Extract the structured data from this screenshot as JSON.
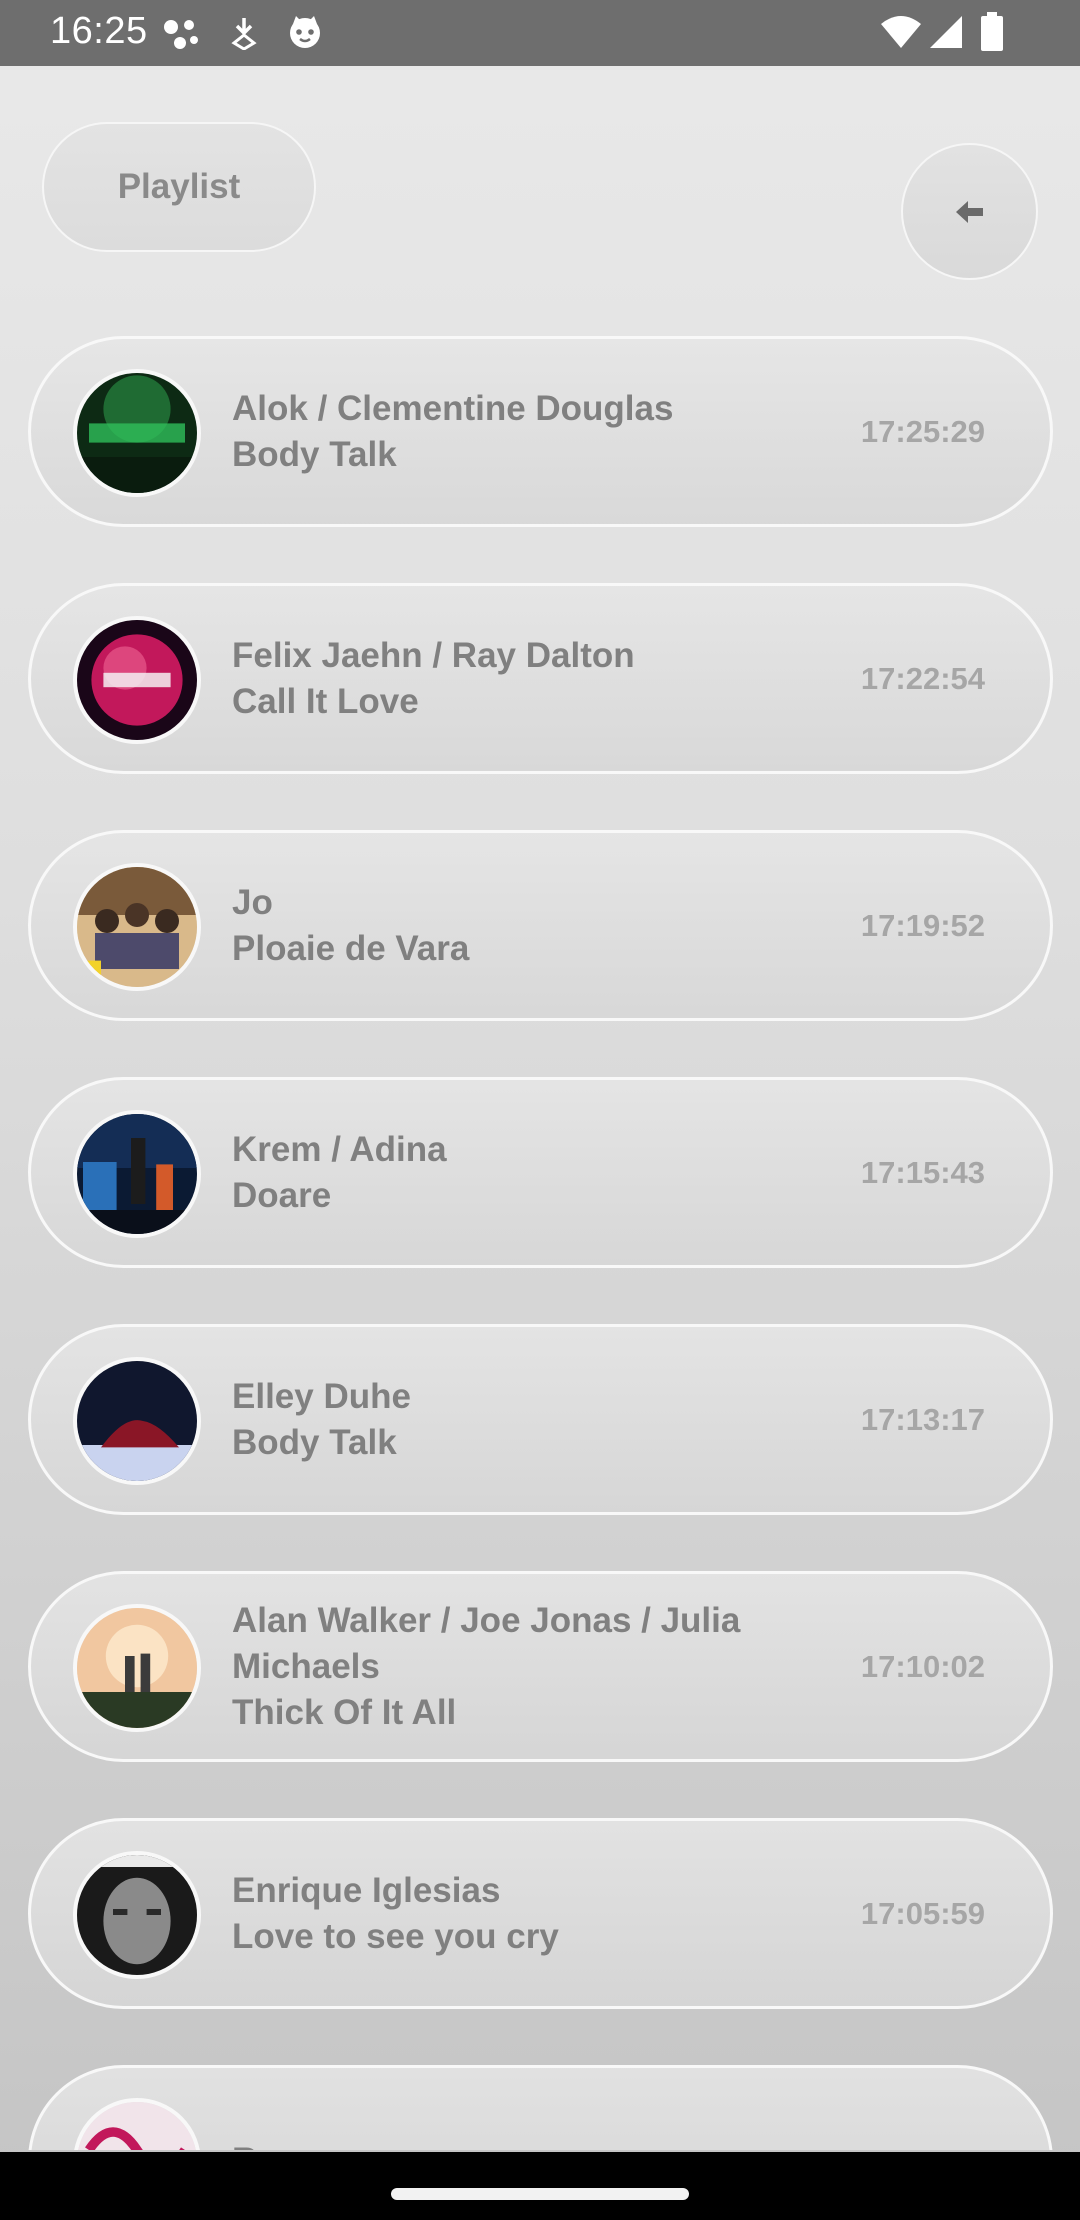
{
  "status_bar": {
    "time": "16:25",
    "left_icons": [
      "cluster-dots-icon",
      "download-arrow-icon",
      "cat-face-icon"
    ],
    "right_icons": [
      "wifi-icon",
      "cellular-signal-icon",
      "battery-icon"
    ]
  },
  "header": {
    "playlist_label": "Playlist",
    "back_icon": "arrow-left-icon"
  },
  "tracks": [
    {
      "artist": "Alok / Clementine Douglas",
      "title": "Body Talk",
      "time": "17:25:29",
      "cover": "green neon album art"
    },
    {
      "artist": "Felix Jaehn / Ray Dalton",
      "title": "Call It Love",
      "time": "17:22:54",
      "cover": "pink planet album art"
    },
    {
      "artist": "Jo",
      "title": "Ploaie de Vara",
      "time": "17:19:52",
      "cover": "group photo album art"
    },
    {
      "artist": "Krem / Adina",
      "title": "Doare",
      "time": "17:15:43",
      "cover": "night scene album art"
    },
    {
      "artist": "Elley Duhe",
      "title": "Body Talk",
      "time": "17:13:17",
      "cover": "red fabric album art"
    },
    {
      "artist": "Alan Walker / Joe Jonas / Julia Michaels",
      "title": "Thick Of It All",
      "time": "17:10:02",
      "cover": "sunset figures album art"
    },
    {
      "artist": "Enrique Iglesias",
      "title": "Love to see you cry",
      "time": "17:05:59",
      "cover": "portrait album art"
    },
    {
      "artist": "Roxen",
      "title": "",
      "time": "",
      "cover": "pink graffiti album art"
    }
  ],
  "colors": {
    "status_bar": "#6e6e6e",
    "card_border": "#f8f8f8",
    "text": "#808080",
    "time_text": "#a6a6a6"
  }
}
